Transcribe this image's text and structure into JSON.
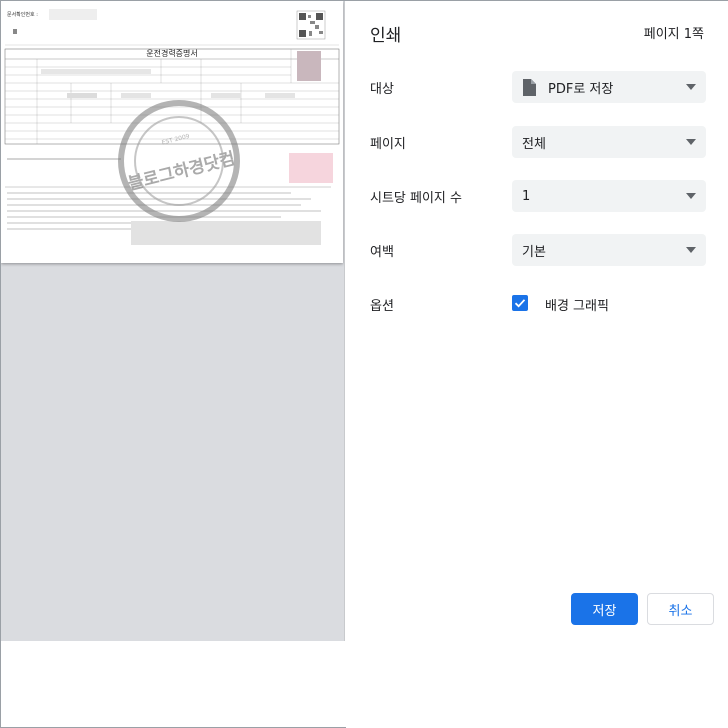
{
  "dialog": {
    "title": "인쇄",
    "page_count": "페이지 1쪽"
  },
  "settings": {
    "destination": {
      "label": "대상",
      "value": "PDF로 저장"
    },
    "pages": {
      "label": "페이지",
      "value": "전체"
    },
    "pages_per_sheet": {
      "label": "시트당 페이지 수",
      "value": "1"
    },
    "margins": {
      "label": "여백",
      "value": "기본"
    },
    "options": {
      "label": "옵션",
      "background_graphics_label": "배경 그래픽",
      "background_graphics_checked": true
    }
  },
  "buttons": {
    "save": "저장",
    "cancel": "취소"
  },
  "preview": {
    "doc_number_label": "문서확인번호 :",
    "doc_title": "운전경력증명서",
    "watermark": "블로그하경닷컴",
    "stamp_text": "EST 2009"
  },
  "colors": {
    "accent": "#1a73e8",
    "select_bg": "#f1f3f4",
    "preview_bg": "#dadce0"
  }
}
